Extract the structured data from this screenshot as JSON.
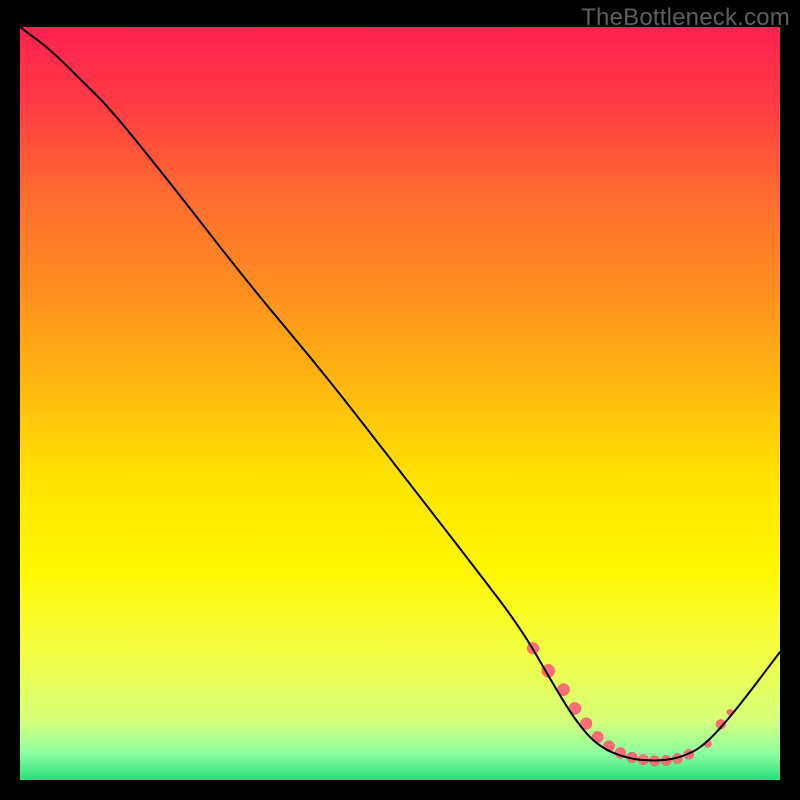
{
  "watermark": "TheBottleneck.com",
  "chart_data": {
    "type": "line",
    "title": "",
    "xlabel": "",
    "ylabel": "",
    "xlim": [
      0,
      100
    ],
    "ylim": [
      0,
      100
    ],
    "grid": false,
    "legend": false,
    "background": {
      "type": "vertical-gradient",
      "stops": [
        {
          "offset": 0.0,
          "color": "#ff2150"
        },
        {
          "offset": 0.1,
          "color": "#ff3a44"
        },
        {
          "offset": 0.22,
          "color": "#ff6a30"
        },
        {
          "offset": 0.35,
          "color": "#ff8f20"
        },
        {
          "offset": 0.48,
          "color": "#ffb910"
        },
        {
          "offset": 0.6,
          "color": "#ffe300"
        },
        {
          "offset": 0.72,
          "color": "#fff700"
        },
        {
          "offset": 0.84,
          "color": "#f2ff4a"
        },
        {
          "offset": 0.92,
          "color": "#d6ff7a"
        },
        {
          "offset": 0.965,
          "color": "#8dffa0"
        },
        {
          "offset": 1.0,
          "color": "#2bdc7b"
        }
      ]
    },
    "series": [
      {
        "name": "curve",
        "color": "#000000",
        "stroke_width": 2,
        "x": [
          0,
          4,
          8,
          12,
          20,
          30,
          40,
          50,
          60,
          66,
          70,
          73,
          76,
          80,
          84,
          87,
          90,
          94,
          100
        ],
        "y": [
          100,
          97,
          93,
          89,
          79,
          66,
          54,
          41,
          28,
          20,
          13,
          8,
          4.5,
          2.8,
          2.5,
          3.0,
          4.5,
          9,
          17
        ]
      }
    ],
    "markers": {
      "name": "highlight",
      "radius_range": [
        3.0,
        6.5
      ],
      "fill": "#ff6e74",
      "stroke": "#f24b5a",
      "points_x": [
        67.5,
        69.5,
        71.5,
        73.0,
        74.5,
        76.0,
        77.5,
        79.0,
        80.5,
        82.0,
        83.5,
        85.0,
        86.5,
        88.0,
        90.5,
        92.2,
        93.4
      ],
      "points_y": [
        17.5,
        14.5,
        12.0,
        9.5,
        7.5,
        5.7,
        4.5,
        3.6,
        3.0,
        2.7,
        2.55,
        2.6,
        2.85,
        3.4,
        4.8,
        7.4,
        9.0
      ],
      "points_r": [
        5.8,
        6.5,
        6.0,
        6.0,
        5.8,
        5.7,
        5.5,
        5.4,
        5.3,
        5.2,
        5.2,
        5.1,
        5.0,
        5.0,
        3.6,
        4.8,
        3.0
      ]
    }
  }
}
